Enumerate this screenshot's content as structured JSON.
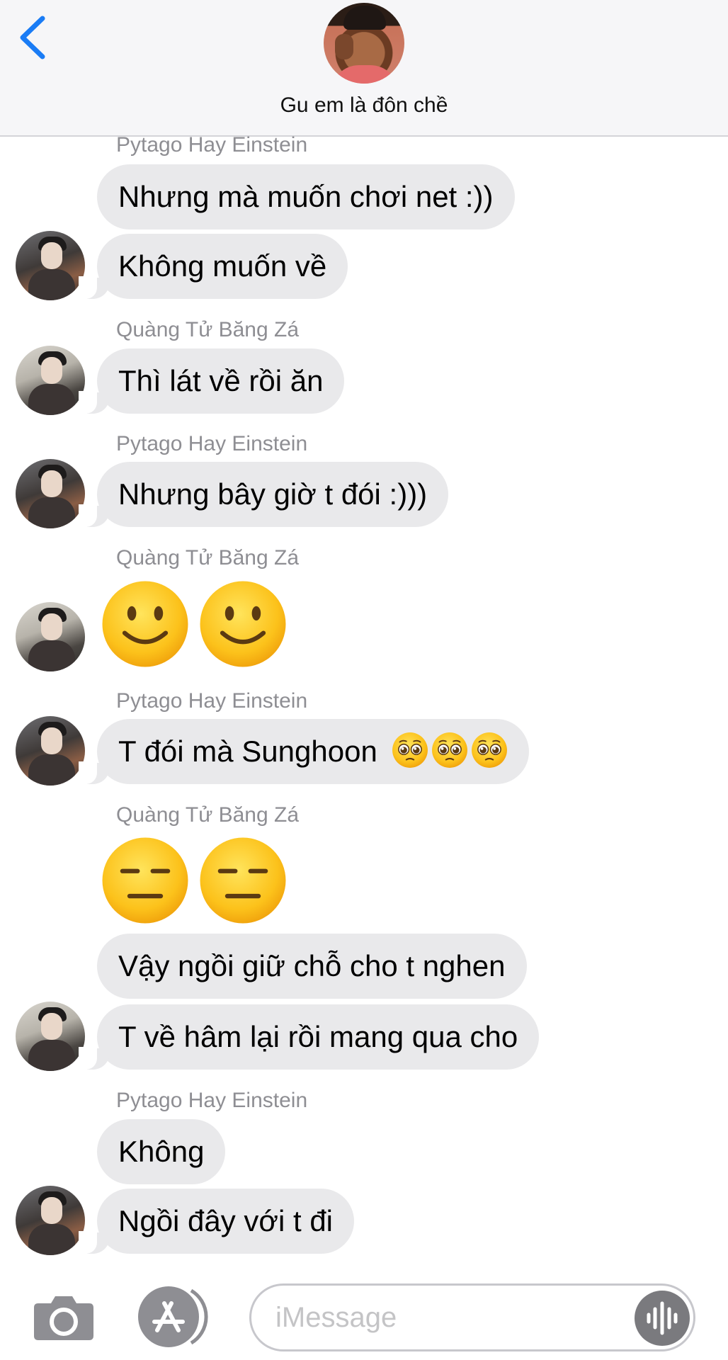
{
  "header": {
    "contact_name": "Gu em là đôn chề"
  },
  "messages": [
    {
      "sender": "Pytago Hay Einstein",
      "text": "Nhưng mà muốn chơi net :))"
    },
    {
      "text": "Không muốn về"
    },
    {
      "sender": "Quàng Tử Băng Zá",
      "text": "Thì lát về rồi ăn"
    },
    {
      "sender": "Pytago Hay Einstein",
      "text": "Nhưng bây giờ t đói :)))"
    },
    {
      "sender": "Quàng Tử Băng Zá",
      "emoji": [
        "slightly-smiling-face",
        "slightly-smiling-face"
      ]
    },
    {
      "sender": "Pytago Hay Einstein",
      "text": "T đói mà Sunghoon",
      "emoji": [
        "pleading-face",
        "pleading-face",
        "pleading-face"
      ]
    },
    {
      "sender": "Quàng Tử Băng Zá",
      "emoji": [
        "expressionless-face",
        "expressionless-face"
      ]
    },
    {
      "text": "Vậy ngồi giữ chỗ cho t nghen"
    },
    {
      "text": "T về hâm lại rồi mang qua cho"
    },
    {
      "sender": "Pytago Hay Einstein",
      "text": "Không"
    },
    {
      "text": "Ngồi đây với t đi"
    }
  ],
  "input": {
    "placeholder": "iMessage"
  },
  "colors": {
    "accent": "#1a7cf5",
    "bubble_incoming": "#e9e9eb",
    "sender_name": "#8e8e93"
  }
}
